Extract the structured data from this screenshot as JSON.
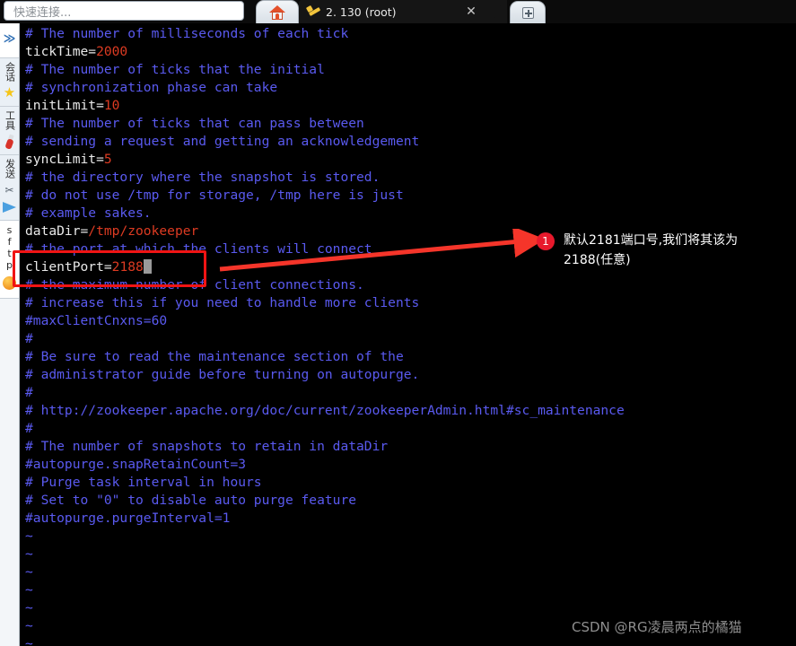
{
  "window": {
    "quick_connect_placeholder": "快速连接...",
    "home_tab_icon": "home-icon",
    "new_tab_icon": "plus-icon"
  },
  "tabs": [
    {
      "label": "2. 130  (root)",
      "icon": "wrench-icon",
      "close": "✕",
      "active": true
    }
  ],
  "sidebar": {
    "expand_glyph": "≫",
    "groups": [
      {
        "label": "会话",
        "icon": "star-icon"
      },
      {
        "label": "工具",
        "icon": "knife-icon"
      },
      {
        "label": "发送",
        "icon": "plane-icon"
      },
      {
        "label": "sftp",
        "icon": "globe-icon"
      }
    ]
  },
  "terminal": {
    "file_type": "zookeeper-config",
    "lines": [
      {
        "type": "comment",
        "text": "# The number of milliseconds of each tick"
      },
      {
        "type": "kv",
        "key": "tickTime=",
        "value": "2000"
      },
      {
        "type": "comment",
        "text": "# The number of ticks that the initial"
      },
      {
        "type": "comment",
        "text": "# synchronization phase can take"
      },
      {
        "type": "kv",
        "key": "initLimit=",
        "value": "10"
      },
      {
        "type": "comment",
        "text": "# The number of ticks that can pass between"
      },
      {
        "type": "comment",
        "text": "# sending a request and getting an acknowledgement"
      },
      {
        "type": "kv",
        "key": "syncLimit=",
        "value": "5"
      },
      {
        "type": "comment",
        "text": "# the directory where the snapshot is stored."
      },
      {
        "type": "comment",
        "text": "# do not use /tmp for storage, /tmp here is just"
      },
      {
        "type": "comment",
        "text": "# example sakes."
      },
      {
        "type": "kv",
        "key": "dataDir=",
        "value": "/tmp/zookeeper"
      },
      {
        "type": "comment",
        "text": "# the port at which the clients will connect"
      },
      {
        "type": "kv-cursor",
        "key": "clientPort=",
        "value": "2188"
      },
      {
        "type": "comment",
        "text": "# the maximum number of client connections."
      },
      {
        "type": "comment",
        "text": "# increase this if you need to handle more clients"
      },
      {
        "type": "comment",
        "text": "#maxClientCnxns=60"
      },
      {
        "type": "comment",
        "text": "#"
      },
      {
        "type": "comment",
        "text": "# Be sure to read the maintenance section of the"
      },
      {
        "type": "comment",
        "text": "# administrator guide before turning on autopurge."
      },
      {
        "type": "comment",
        "text": "#"
      },
      {
        "type": "comment",
        "text": "# http://zookeeper.apache.org/doc/current/zookeeperAdmin.html#sc_maintenance"
      },
      {
        "type": "comment",
        "text": "#"
      },
      {
        "type": "comment",
        "text": "# The number of snapshots to retain in dataDir"
      },
      {
        "type": "comment",
        "text": "#autopurge.snapRetainCount=3"
      },
      {
        "type": "comment",
        "text": "# Purge task interval in hours"
      },
      {
        "type": "comment",
        "text": "# Set to \"0\" to disable auto purge feature"
      },
      {
        "type": "comment",
        "text": "#autopurge.purgeInterval=1"
      },
      {
        "type": "tilde",
        "text": "~"
      },
      {
        "type": "tilde",
        "text": "~"
      },
      {
        "type": "tilde",
        "text": "~"
      },
      {
        "type": "tilde",
        "text": "~"
      },
      {
        "type": "tilde",
        "text": "~"
      },
      {
        "type": "tilde",
        "text": "~"
      },
      {
        "type": "tilde",
        "text": "~"
      }
    ]
  },
  "annotation": {
    "badge": "1",
    "text": "默认2181端口号,我们将其该为 2188(任意)",
    "highlight_target": "clientPort=2188",
    "color": "#f01414",
    "badge_color": "#e8192c"
  },
  "watermark": {
    "text": "CSDN @RG凌晨两点的橘猫"
  },
  "colors": {
    "terminal_bg": "#000000",
    "comment": "#5a5af0",
    "key": "#e9e9e9",
    "value": "#dd3b22",
    "annotation_red": "#f01414"
  }
}
